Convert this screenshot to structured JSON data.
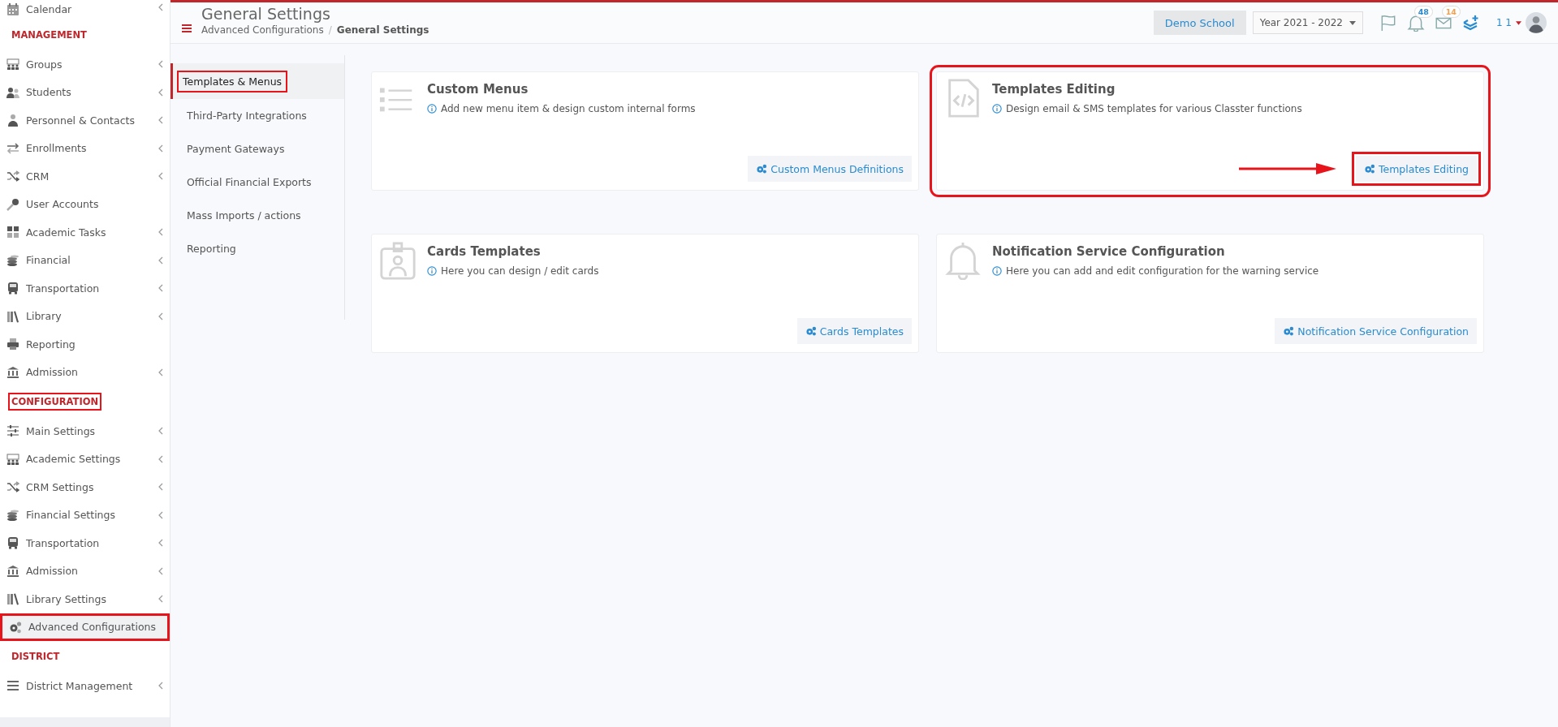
{
  "sidebar": {
    "items": [
      {
        "kind": "item",
        "label": "Calendar",
        "expandable": true,
        "selected": false,
        "highlighted": false
      },
      {
        "kind": "heading",
        "label": "MANAGEMENT",
        "highlighted": false
      },
      {
        "kind": "item",
        "label": "Groups",
        "expandable": true,
        "selected": false,
        "highlighted": false
      },
      {
        "kind": "item",
        "label": "Students",
        "expandable": true,
        "selected": false,
        "highlighted": false
      },
      {
        "kind": "item",
        "label": "Personnel & Contacts",
        "expandable": true,
        "selected": false,
        "highlighted": false
      },
      {
        "kind": "item",
        "label": "Enrollments",
        "expandable": true,
        "selected": false,
        "highlighted": false
      },
      {
        "kind": "item",
        "label": "CRM",
        "expandable": true,
        "selected": false,
        "highlighted": false
      },
      {
        "kind": "item",
        "label": "User Accounts",
        "expandable": false,
        "selected": false,
        "highlighted": false
      },
      {
        "kind": "item",
        "label": "Academic Tasks",
        "expandable": true,
        "selected": false,
        "highlighted": false
      },
      {
        "kind": "item",
        "label": "Financial",
        "expandable": true,
        "selected": false,
        "highlighted": false
      },
      {
        "kind": "item",
        "label": "Transportation",
        "expandable": true,
        "selected": false,
        "highlighted": false
      },
      {
        "kind": "item",
        "label": "Library",
        "expandable": true,
        "selected": false,
        "highlighted": false
      },
      {
        "kind": "item",
        "label": "Reporting",
        "expandable": false,
        "selected": false,
        "highlighted": false
      },
      {
        "kind": "item",
        "label": "Admission",
        "expandable": true,
        "selected": false,
        "highlighted": false
      },
      {
        "kind": "heading",
        "label": "CONFIGURATION",
        "highlighted": true
      },
      {
        "kind": "item",
        "label": "Main Settings",
        "expandable": true,
        "selected": false,
        "highlighted": false
      },
      {
        "kind": "item",
        "label": "Academic Settings",
        "expandable": true,
        "selected": false,
        "highlighted": false
      },
      {
        "kind": "item",
        "label": "CRM Settings",
        "expandable": true,
        "selected": false,
        "highlighted": false
      },
      {
        "kind": "item",
        "label": "Financial Settings",
        "expandable": true,
        "selected": false,
        "highlighted": false
      },
      {
        "kind": "item",
        "label": "Transportation",
        "expandable": true,
        "selected": false,
        "highlighted": false
      },
      {
        "kind": "item",
        "label": "Admission",
        "expandable": true,
        "selected": false,
        "highlighted": false
      },
      {
        "kind": "item",
        "label": "Library Settings",
        "expandable": true,
        "selected": false,
        "highlighted": false
      },
      {
        "kind": "item",
        "label": "Advanced Configurations",
        "expandable": false,
        "selected": true,
        "highlighted": true
      },
      {
        "kind": "heading",
        "label": "DISTRICT",
        "highlighted": false
      },
      {
        "kind": "item",
        "label": "District Management",
        "expandable": true,
        "selected": false,
        "highlighted": false
      }
    ]
  },
  "header": {
    "title": "General Settings",
    "breadcrumb": [
      {
        "label": "Advanced Configurations",
        "current": false
      },
      {
        "label": "General Settings",
        "current": true
      }
    ],
    "breadcrumb_separator": "/",
    "school": "Demo School",
    "year": "Year 2021 - 2022",
    "notifications_badge": "48",
    "messages_badge": "14",
    "user": "1 1"
  },
  "tabs": [
    {
      "label": "Templates & Menus",
      "selected": true,
      "highlighted": true
    },
    {
      "label": "Third-Party Integrations",
      "selected": false,
      "highlighted": false
    },
    {
      "label": "Payment Gateways",
      "selected": false,
      "highlighted": false
    },
    {
      "label": "Official Financial Exports",
      "selected": false,
      "highlighted": false
    },
    {
      "label": "Mass Imports / actions",
      "selected": false,
      "highlighted": false
    },
    {
      "label": "Reporting",
      "selected": false,
      "highlighted": false
    }
  ],
  "cards": [
    {
      "title": "Custom Menus",
      "description": "Add new menu item & design custom internal forms",
      "button": "Custom Menus Definitions",
      "highlighted": false,
      "arrow": false
    },
    {
      "title": "Templates Editing",
      "description": "Design email & SMS templates for various Classter functions",
      "button": "Templates Editing",
      "highlighted": true,
      "arrow": true
    },
    {
      "title": "Cards Templates",
      "description": "Here you can design / edit cards",
      "button": "Cards Templates",
      "highlighted": false,
      "arrow": false
    },
    {
      "title": "Notification Service Configuration",
      "description": "Here you can add and edit configuration for the warning service",
      "button": "Notification Service Configuration",
      "highlighted": false,
      "arrow": false
    }
  ]
}
